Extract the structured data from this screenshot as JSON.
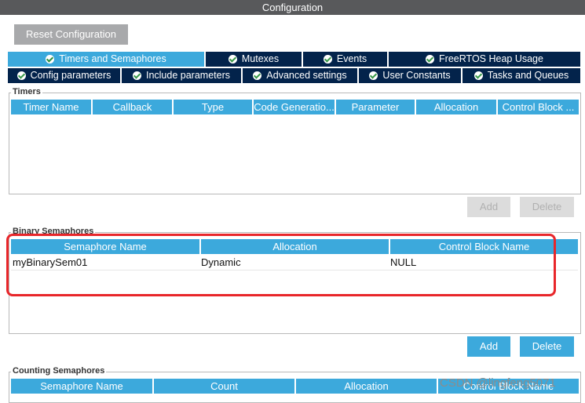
{
  "window": {
    "title": "Configuration"
  },
  "toolbar": {
    "reset_label": "Reset Configuration"
  },
  "tabs_row1": [
    {
      "label": "Timers and Semaphores",
      "active": true
    },
    {
      "label": "Mutexes"
    },
    {
      "label": "Events"
    },
    {
      "label": "FreeRTOS Heap Usage"
    }
  ],
  "tabs_row2": [
    {
      "label": "Config parameters"
    },
    {
      "label": "Include parameters"
    },
    {
      "label": "Advanced settings"
    },
    {
      "label": "User Constants"
    },
    {
      "label": "Tasks and Queues"
    }
  ],
  "timers": {
    "title": "Timers",
    "columns": [
      "Timer Name",
      "Callback",
      "Type",
      "Code Generatio...",
      "Parameter",
      "Allocation",
      "Control Block ..."
    ],
    "add_label": "Add",
    "delete_label": "Delete"
  },
  "binary": {
    "title": "Binary Semaphores",
    "columns": [
      "Semaphore Name",
      "Allocation",
      "Control Block Name"
    ],
    "rows": [
      [
        "myBinarySem01",
        "Dynamic",
        "NULL"
      ]
    ],
    "add_label": "Add",
    "delete_label": "Delete"
  },
  "counting": {
    "title": "Counting Semaphores",
    "columns": [
      "Semaphore Name",
      "Count",
      "Allocation",
      "Control Block Name"
    ]
  },
  "watermark": "CSDN @lingfeng5071",
  "colors": {
    "accent": "#3ca9dc",
    "tab_dark": "#03234b",
    "titlebar": "#58595b",
    "highlight": "#e8262a"
  }
}
